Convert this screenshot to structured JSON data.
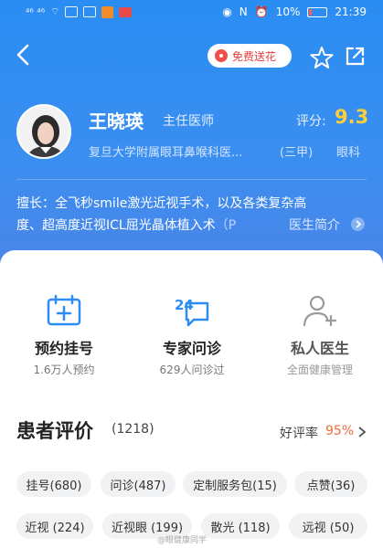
{
  "statusbar": {
    "left_text": "⁴⁶ ⁴⁶",
    "battery_percent": "10%",
    "time": "21:39"
  },
  "header": {
    "flower_button": "免费送花"
  },
  "doctor": {
    "name": "王晓瑛",
    "title": "主任医师",
    "score_label": "评分:",
    "score": "9.3",
    "hospital": "复旦大学附属眼耳鼻喉科医...",
    "hospital_level": "(三甲)",
    "department": "眼科",
    "intro_line1": "擅长：全飞秒smile激光近视手术，以及各类复杂高",
    "intro_line2": "度、超高度近视ICL屈光晶体植入术",
    "intro_more": "（P",
    "intro_link": "医生简介"
  },
  "services": [
    {
      "name": "预约挂号",
      "sub": "1.6万人预约",
      "icon": "calendar-plus-icon"
    },
    {
      "name": "专家问诊",
      "sub": "629人问诊过",
      "icon": "chat-24-icon",
      "badge": "24"
    },
    {
      "name": "私人医生",
      "sub": "全面健康管理",
      "icon": "user-plus-icon"
    }
  ],
  "reviews": {
    "title": "患者评价",
    "count": "(1218)",
    "good_label": "好评率",
    "good_rate": "95%",
    "tags_row1": [
      "挂号(680)",
      "问诊(487)",
      "定制服务包(15)",
      "点赞(36)"
    ],
    "tags_row2": [
      "近视 (224)",
      "近视眼 (199)",
      "散光 (118)",
      "远视 (50)"
    ]
  },
  "watermark": "@眼健康同学",
  "colors": {
    "brand_blue": "#3a8ef0",
    "score_yellow": "#ffcf3a",
    "flower_red": "#e63c3c",
    "rate_orange": "#f06a3a"
  }
}
